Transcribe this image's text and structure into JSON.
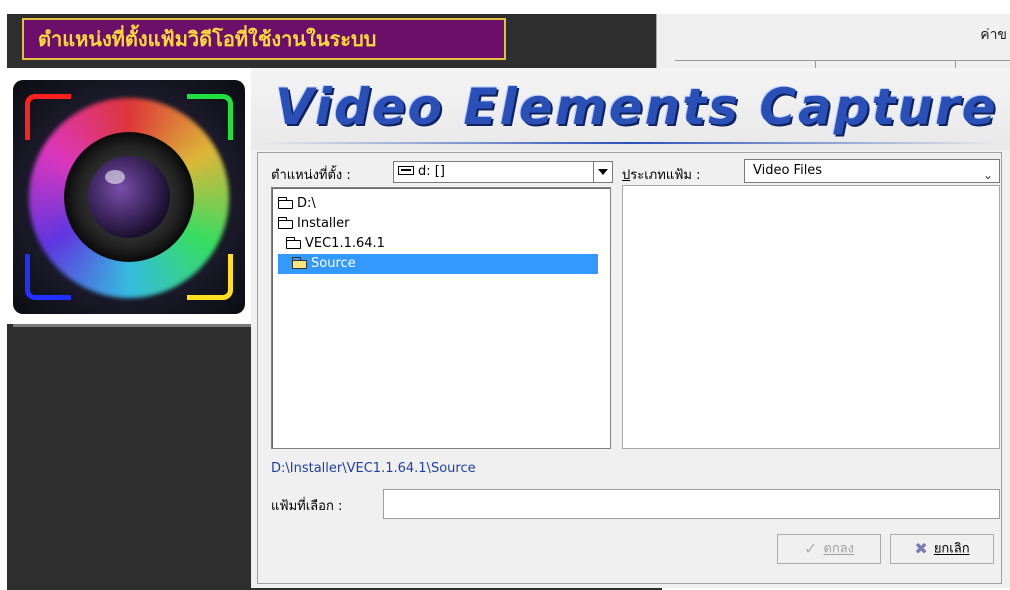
{
  "banner": {
    "text": "ตำแหน่งที่ตั้งแฟ้มวิดีโอที่ใช้งานในระบบ",
    "bg_color": "#6b0f6b",
    "text_color": "#ffd83a"
  },
  "background_window": {
    "title_fragment": "ค่าข"
  },
  "dialog": {
    "app_title": "Video Elements Capture",
    "logo_icon": "camera-lens-icon",
    "location_label": "ตำแหน่งที่ตั้ง :",
    "drive_select": {
      "icon": "drive-icon",
      "value": "d: []"
    },
    "file_type_label": "ประเภทแฟ้ม :",
    "file_type_underline_char": "ป",
    "file_type_select": {
      "value": "Video Files"
    },
    "folder_tree": [
      {
        "label": "D:\\",
        "level": 0,
        "icon": "folder-open-icon",
        "selected": false
      },
      {
        "label": "Installer",
        "level": 0,
        "icon": "folder-open-icon",
        "selected": false
      },
      {
        "label": "VEC1.1.64.1",
        "level": 1,
        "icon": "folder-open-icon",
        "selected": false
      },
      {
        "label": "Source",
        "level": 2,
        "icon": "folder-open-icon",
        "selected": true
      }
    ],
    "file_list": [],
    "current_path": "D:\\Installer\\VEC1.1.64.1\\Source",
    "selected_file_label": "แฟ้มที่เลือก :",
    "selected_file_value": "",
    "ok_button": {
      "label": "ตกลง",
      "icon": "checkmark-icon",
      "enabled": false
    },
    "cancel_button": {
      "label": "ยกเลิก",
      "icon": "cancel-x-icon",
      "enabled": true
    },
    "colors": {
      "title_blue": "#2a50b8",
      "selection": "#3399ff",
      "path_text": "#1f3fa8"
    }
  }
}
